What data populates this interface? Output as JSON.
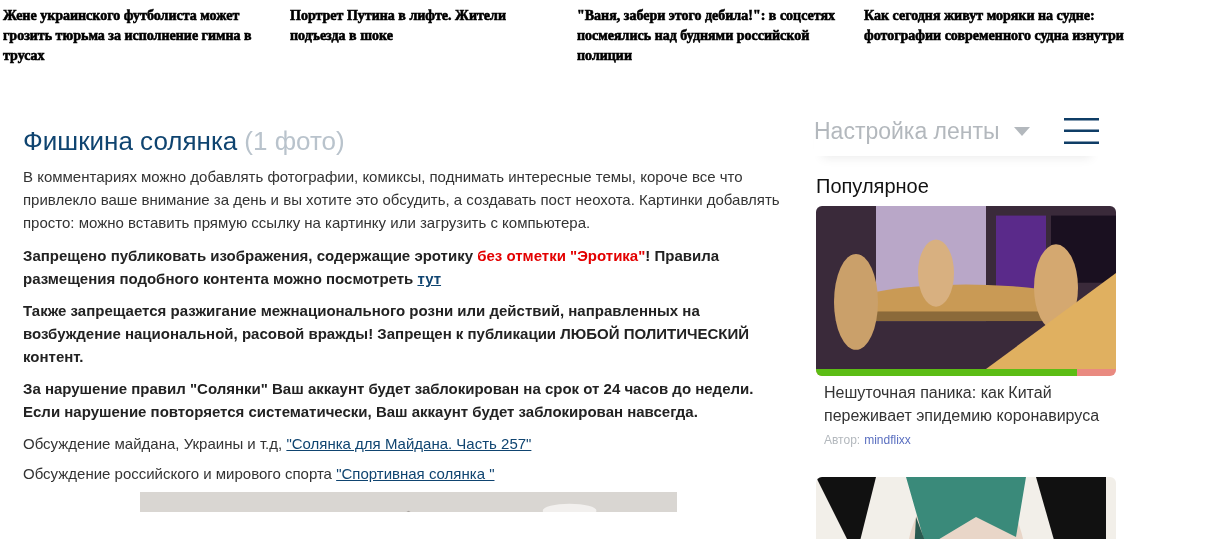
{
  "headlines": [
    {
      "text": "Жене украинского футболиста может грозить тюрьма за исполнение гимна в трусах"
    },
    {
      "text": "Портрет Путина в лифте. Жители подъезда в шоке"
    },
    {
      "text": "\"Ваня, забери этого дебила!\": в соцсетях посмеялись над буднями российской полиции"
    },
    {
      "text": "Как сегодня живут моряки на судне: фотографии современного судна изнутри"
    }
  ],
  "article": {
    "title": "Фишкина солянка",
    "count": "(1 фото)",
    "intro": "В комментариях можно добавлять фотографии, комиксы, поднимать интересные темы, короче все что привлекло ваше внимание за день и вы хотите это обсудить, а создавать пост неохота. Картинки добавлять просто: можно вставить прямую ссылку на картинку или загрузить с компьютера.",
    "rules": [
      {
        "parts": [
          {
            "kind": "text",
            "text": "Запрещено публиковать изображения, содержащие эротику "
          },
          {
            "kind": "warning",
            "text": "без отметки \"Эротика\""
          },
          {
            "kind": "text",
            "text": "! Правила размещения подобного контента можно посмотреть "
          },
          {
            "kind": "link",
            "text": "тут"
          }
        ]
      },
      {
        "parts": [
          {
            "kind": "text",
            "text": "Также запрещается разжигание межнационального розни или действий, направленных на возбуждение национальной, расовой вражды! Запрещен к публикации ЛЮБОЙ ПОЛИТИЧЕСКИЙ контент."
          }
        ]
      },
      {
        "parts": [
          {
            "kind": "text",
            "text": "За нарушение правил \"Солянки\" Ваш аккаунт будет заблокирован на срок от 24 часов до недели. Если нарушение повторяется систематически, Ваш аккаунт будет заблокирован навсегда."
          }
        ]
      }
    ],
    "links": [
      {
        "text": "Обсуждение майдана, Украины и т.д, ",
        "link": "\"Солянка для Майдана. Часть 257\""
      },
      {
        "text": "Обсуждение российского и мирового спорта ",
        "link": "\"Спортивная солянка \""
      }
    ],
    "image": {
      "kind": "picture"
    }
  },
  "sidebar": {
    "feed_settings": "Настройка ленты",
    "section_title": "Популярное",
    "cards": [
      {
        "image": {
          "kind": "picture"
        },
        "level": 0.87,
        "title": "Нешуточная паника: как Китай переживает эпидемию коронавируса",
        "author_label": "Автор:",
        "author": "mindflixx"
      },
      {
        "image": {
          "kind": "picture"
        }
      }
    ]
  }
}
